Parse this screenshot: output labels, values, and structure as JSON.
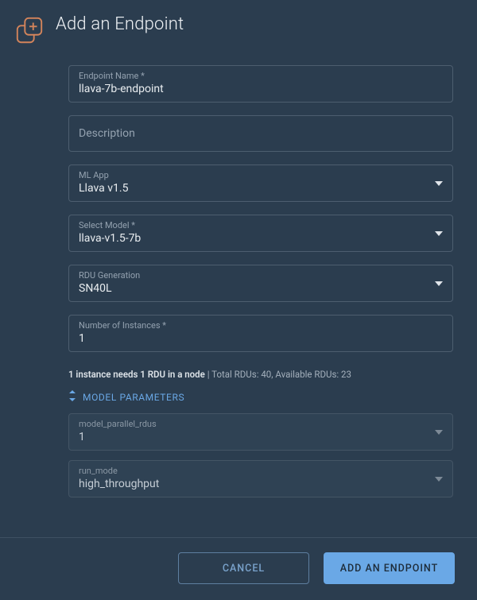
{
  "header": {
    "title": "Add an Endpoint"
  },
  "fields": {
    "endpoint_name": {
      "label": "Endpoint Name *",
      "value": "llava-7b-endpoint"
    },
    "description": {
      "placeholder": "Description"
    },
    "ml_app": {
      "label": "ML App",
      "value": "Llava v1.5"
    },
    "select_model": {
      "label": "Select Model *",
      "value": "llava-v1.5-7b"
    },
    "rdu_generation": {
      "label": "RDU Generation",
      "value": "SN40L"
    },
    "num_instances": {
      "label": "Number of Instances *",
      "value": "1"
    }
  },
  "info": {
    "bold": "1 instance needs 1 RDU in a node",
    "rest": " | Total RDUs: 40, Available RDUs: 23"
  },
  "params_toggle": {
    "label": "MODEL PARAMETERS"
  },
  "params": {
    "model_parallel_rdus": {
      "label": "model_parallel_rdus",
      "value": "1"
    },
    "run_mode": {
      "label": "run_mode",
      "value": "high_throughput"
    }
  },
  "footer": {
    "cancel": "CANCEL",
    "submit": "ADD AN ENDPOINT"
  }
}
